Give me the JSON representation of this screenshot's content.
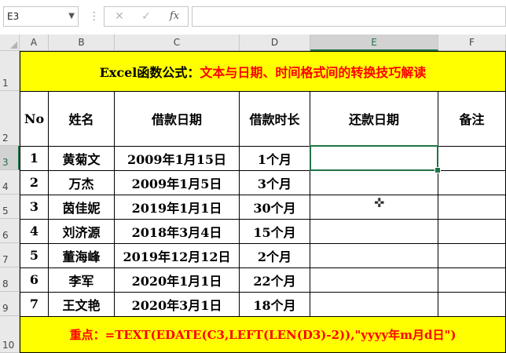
{
  "name_box": {
    "value": "E3"
  },
  "formula_bar": {
    "cancel_icon": "✕",
    "enter_icon": "✓",
    "fx_label": "fx",
    "value": ""
  },
  "columns": [
    "A",
    "B",
    "C",
    "D",
    "E",
    "F"
  ],
  "rows": [
    "1",
    "2",
    "3",
    "4",
    "5",
    "6",
    "7",
    "8",
    "9",
    "10"
  ],
  "selected_cell": "E3",
  "title": {
    "part1": "Excel函数公式：",
    "part2": "文本与日期、时间格式间的转换技巧解读"
  },
  "headers": {
    "no": "No",
    "name": "姓名",
    "loan_date": "借款日期",
    "duration": "借款时长",
    "return_date": "还款日期",
    "note": "备注"
  },
  "table_rows": [
    {
      "no": "1",
      "name": "黄菊文",
      "loan_date": "2009年1月15日",
      "duration": "1个月",
      "return_date": "",
      "note": ""
    },
    {
      "no": "2",
      "name": "万杰",
      "loan_date": "2009年1月5日",
      "duration": "3个月",
      "return_date": "",
      "note": ""
    },
    {
      "no": "3",
      "name": "茵佳妮",
      "loan_date": "2019年1月1日",
      "duration": "30个月",
      "return_date": "",
      "note": ""
    },
    {
      "no": "4",
      "name": "刘济源",
      "loan_date": "2018年3月4日",
      "duration": "15个月",
      "return_date": "",
      "note": ""
    },
    {
      "no": "5",
      "name": "董海峰",
      "loan_date": "2019年12月12日",
      "duration": "2个月",
      "return_date": "",
      "note": ""
    },
    {
      "no": "6",
      "name": "李军",
      "loan_date": "2020年1月1日",
      "duration": "22个月",
      "return_date": "",
      "note": ""
    },
    {
      "no": "7",
      "name": "王文艳",
      "loan_date": "2020年3月1日",
      "duration": "18个月",
      "return_date": "",
      "note": ""
    }
  ],
  "footer": {
    "text": "重点：=TEXT(EDATE(C3,LEFT(LEN(D3)-2)),\"yyyy年m月d日\")"
  },
  "icons": {
    "cursor": "crosshair-cursor-icon"
  },
  "colors": {
    "title_bg": "#ffff00",
    "title_accent": "#ff0000",
    "selection": "#217346"
  }
}
